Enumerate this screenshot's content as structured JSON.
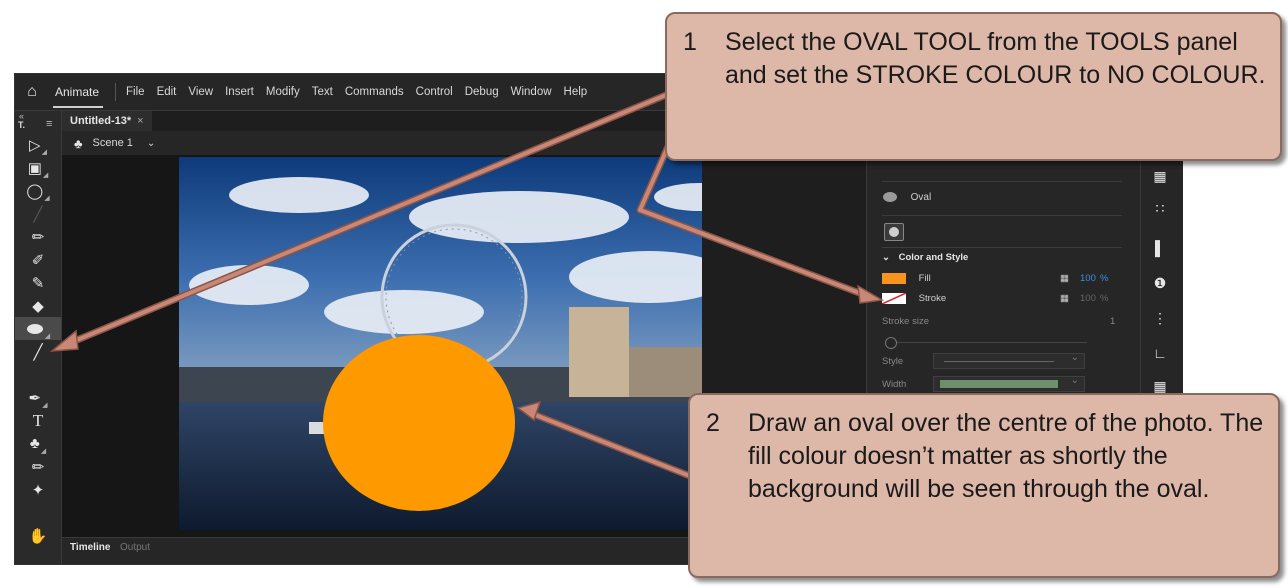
{
  "menubar": {
    "app_name": "Animate",
    "items": [
      "File",
      "Edit",
      "View",
      "Insert",
      "Modify",
      "Text",
      "Commands",
      "Control",
      "Debug",
      "Window",
      "Help"
    ]
  },
  "document": {
    "tab_title": "Untitled-13*",
    "tab_close": "×",
    "scene_label": "Scene 1"
  },
  "toolbar": {
    "panel_label": "T."
  },
  "properties": {
    "tool_name": "Oval",
    "section_title": "Color and Style",
    "fill_label": "Fill",
    "fill_percent": "100",
    "fill_unit": "%",
    "stroke_label": "Stroke",
    "stroke_percent": "100",
    "stroke_unit": "%",
    "stroke_size_label": "Stroke size",
    "stroke_size_value": "1",
    "style_label": "Style",
    "width_label": "Width",
    "fill_color": "#f7931e"
  },
  "timeline": {
    "tab_timeline": "Timeline",
    "tab_output": "Output"
  },
  "stage": {
    "oval_color": "#ff9900"
  },
  "callouts": {
    "c1_number": "1",
    "c1_text": "Select the OVAL TOOL from the TOOLS panel and set the STROKE COLOUR to NO COLOUR.",
    "c2_number": "2",
    "c2_text": "Draw an oval over the centre of the photo.  The fill colour doesn’t matter as shortly the background will be seen through the oval."
  },
  "colors": {
    "callout_bg": "#ddb7a8",
    "callout_border": "#8a6a5e",
    "arrow": "#b8705e",
    "accent_blue": "#3d8fe0"
  }
}
